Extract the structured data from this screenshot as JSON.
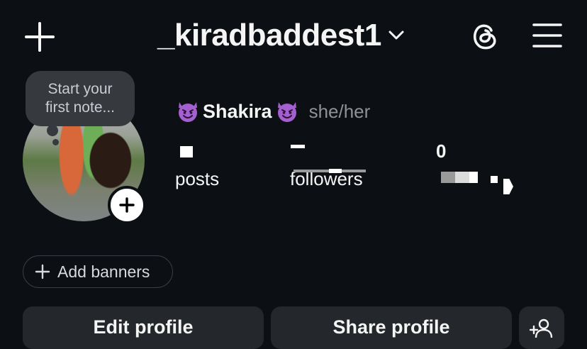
{
  "header": {
    "username": "_kiradbaddest1",
    "icons": [
      "plus-icon",
      "chevron-down-icon",
      "threads-icon",
      "menu-icon"
    ]
  },
  "note": {
    "line1": "Start your",
    "line2": "first note..."
  },
  "profile": {
    "display_name": "Shakira",
    "pronouns": "she/her",
    "emoji": "smiling-devil-emoji"
  },
  "stats": {
    "posts": {
      "label": "posts"
    },
    "followers": {
      "label": "followers"
    },
    "following": {
      "value": "0"
    }
  },
  "banners": {
    "label": "Add banners"
  },
  "actions": {
    "edit_label": "Edit profile",
    "share_label": "Share profile"
  },
  "colors": {
    "background": "#0c1014",
    "button_bg": "#24272b",
    "note_bg": "#363a3f",
    "muted_text": "#8e9297",
    "devil_purple": "#a45fd1"
  }
}
